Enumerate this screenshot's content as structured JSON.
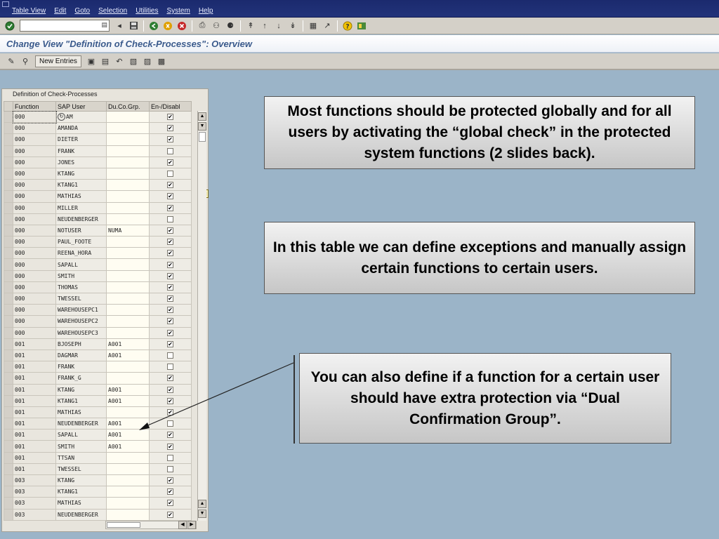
{
  "menubar": {
    "items": [
      "Table View",
      "Edit",
      "Goto",
      "Selection",
      "Utilities",
      "System",
      "Help"
    ]
  },
  "toolbar": {
    "command_field_value": "",
    "icons": [
      "enter-icon",
      "back-icon",
      "save-icon",
      "back-nav-icon",
      "exit-icon",
      "cancel-icon",
      "print-icon",
      "find-icon",
      "find-next-icon",
      "first-page-icon",
      "previous-page-icon",
      "next-page-icon",
      "last-page-icon",
      "new-session-icon",
      "shortcut-icon",
      "help-icon",
      "layout-icon"
    ]
  },
  "title": "Change View \"Definition of Check-Processes\": Overview",
  "apptoolbar": {
    "new_entries_label": "New Entries"
  },
  "table": {
    "caption": "Definition of Check-Processes",
    "columns": [
      "Function",
      "SAP User",
      "Du.Co.Grp.",
      "En-/Disabl"
    ],
    "rows": [
      {
        "function": "000",
        "user": "AM",
        "group": "",
        "enabled": true
      },
      {
        "function": "000",
        "user": "AMANDA",
        "group": "",
        "enabled": true
      },
      {
        "function": "000",
        "user": "DIETER",
        "group": "",
        "enabled": true
      },
      {
        "function": "000",
        "user": "FRANK",
        "group": "",
        "enabled": false
      },
      {
        "function": "000",
        "user": "JONES",
        "group": "",
        "enabled": true
      },
      {
        "function": "000",
        "user": "KTANG",
        "group": "",
        "enabled": false
      },
      {
        "function": "000",
        "user": "KTANG1",
        "group": "",
        "enabled": true
      },
      {
        "function": "000",
        "user": "MATHIAS",
        "group": "",
        "enabled": true
      },
      {
        "function": "000",
        "user": "MILLER",
        "group": "",
        "enabled": true
      },
      {
        "function": "000",
        "user": "NEUDENBERGER",
        "group": "",
        "enabled": false
      },
      {
        "function": "000",
        "user": "NOTUSER",
        "group": "NUMA",
        "enabled": true
      },
      {
        "function": "000",
        "user": "PAUL_FOOTE",
        "group": "",
        "enabled": true
      },
      {
        "function": "000",
        "user": "REENA_HORA",
        "group": "",
        "enabled": true
      },
      {
        "function": "000",
        "user": "SAPALL",
        "group": "",
        "enabled": true
      },
      {
        "function": "000",
        "user": "SMITH",
        "group": "",
        "enabled": true
      },
      {
        "function": "000",
        "user": "THOMAS",
        "group": "",
        "enabled": true
      },
      {
        "function": "000",
        "user": "TWESSEL",
        "group": "",
        "enabled": true
      },
      {
        "function": "000",
        "user": "WAREHOUSEPC1",
        "group": "",
        "enabled": true
      },
      {
        "function": "000",
        "user": "WAREHOUSEPC2",
        "group": "",
        "enabled": true
      },
      {
        "function": "000",
        "user": "WAREHOUSEPC3",
        "group": "",
        "enabled": true
      },
      {
        "function": "001",
        "user": "BJOSEPH",
        "group": "A001",
        "enabled": true
      },
      {
        "function": "001",
        "user": "DAGMAR",
        "group": "A001",
        "enabled": false
      },
      {
        "function": "001",
        "user": "FRANK",
        "group": "",
        "enabled": false
      },
      {
        "function": "001",
        "user": "FRANK_G",
        "group": "",
        "enabled": true
      },
      {
        "function": "001",
        "user": "KTANG",
        "group": "A001",
        "enabled": true
      },
      {
        "function": "001",
        "user": "KTANG1",
        "group": "A001",
        "enabled": true
      },
      {
        "function": "001",
        "user": "MATHIAS",
        "group": "",
        "enabled": true
      },
      {
        "function": "001",
        "user": "NEUDENBERGER",
        "group": "A001",
        "enabled": false
      },
      {
        "function": "001",
        "user": "SAPALL",
        "group": "A001",
        "enabled": true
      },
      {
        "function": "001",
        "user": "SMITH",
        "group": "A001",
        "enabled": true
      },
      {
        "function": "001",
        "user": "TTSAN",
        "group": "",
        "enabled": false
      },
      {
        "function": "001",
        "user": "TWESSEL",
        "group": "",
        "enabled": false
      },
      {
        "function": "003",
        "user": "KTANG",
        "group": "",
        "enabled": true
      },
      {
        "function": "003",
        "user": "KTANG1",
        "group": "",
        "enabled": true
      },
      {
        "function": "003",
        "user": "MATHIAS",
        "group": "",
        "enabled": true
      },
      {
        "function": "003",
        "user": "NEUDENBERGER",
        "group": "",
        "enabled": true
      }
    ]
  },
  "callouts": [
    "Most functions should be protected globally and for all users by activating the “global check” in the protected system functions (2 slides back).",
    "In this table we can define exceptions and manually assign certain functions to certain users.",
    "You can also define if a function for a certain user should have extra protection via “Dual Confirmation Group”."
  ],
  "colors": {
    "background": "#9bb4c8",
    "menubar": "#1b2a6e",
    "title_text": "#3a5a8c"
  }
}
